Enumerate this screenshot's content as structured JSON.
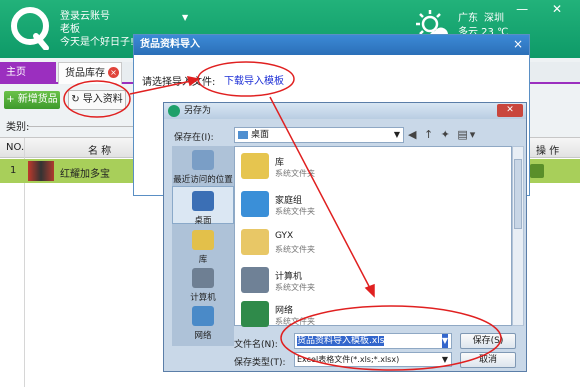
{
  "app": {
    "account": "登录云账号",
    "user": "老板",
    "greeting": "今天是个好日子!",
    "window_controls": "— ✕",
    "weather": {
      "province": "广东",
      "city": "深圳",
      "condition": "多云 23 ℃"
    }
  },
  "tabs": [
    {
      "label": "主页"
    },
    {
      "label": "货品库存"
    }
  ],
  "toolbar": {
    "add_label": "+ 新增货品",
    "import_label": "↻ 导入资料"
  },
  "category": {
    "label": "类别:"
  },
  "grid": {
    "headers": {
      "no": "NO.",
      "name": "名 称",
      "action": "操 作"
    },
    "rows": [
      {
        "no": "1",
        "name": "红耀加多宝"
      }
    ]
  },
  "import_dialog": {
    "title": "货品资料导入",
    "close": "×",
    "prompt": "请选择导入文件:",
    "link": "下载导入模板"
  },
  "save_dialog": {
    "title": "另存为",
    "close": "✕",
    "savein_label": "保存在(I):",
    "savein_value": "桌面",
    "places": [
      "最近访问的位置",
      "桌面",
      "库",
      "计算机",
      "网络"
    ],
    "files": [
      {
        "name": "库",
        "type": "系统文件夹"
      },
      {
        "name": "家庭组",
        "type": "系统文件夹"
      },
      {
        "name": "GYX",
        "type": "系统文件夹"
      },
      {
        "name": "计算机",
        "type": "系统文件夹"
      },
      {
        "name": "网络",
        "type": "系统文件夹"
      }
    ],
    "filename_label": "文件名(N):",
    "filename_value": "货品资料导入模板.xls",
    "filetype_label": "保存类型(T):",
    "filetype_value": "Excel表格文件(*.xls;*.xlsx)",
    "save_button": "保存(S)",
    "cancel_button": "取消"
  },
  "colors": {
    "header_green": "#12a26e",
    "home_tab_purple": "#9b2fbf",
    "annotation_red": "#e02020",
    "row_highlight": "#a8cf5a",
    "link_blue": "#1d2fd6"
  }
}
